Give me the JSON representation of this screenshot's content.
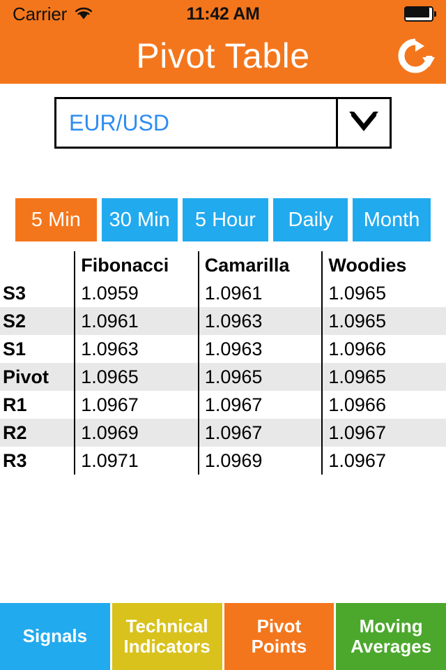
{
  "status_bar": {
    "carrier": "Carrier",
    "wifi_icon": "wifi-icon",
    "time": "11:42 AM",
    "battery_icon": "battery-full-icon"
  },
  "header": {
    "title": "Pivot Table",
    "refresh_icon": "refresh-icon",
    "background_color": "#F4761C"
  },
  "symbol_selector": {
    "value": "EUR/USD",
    "chevron_icon": "chevron-down-icon",
    "value_color": "#2D8CF0"
  },
  "timeframes": {
    "active_index": 0,
    "active_color": "#F4761C",
    "inactive_color": "#22AAEE",
    "items": [
      {
        "label": "5 Min"
      },
      {
        "label": "30 Min"
      },
      {
        "label": "5 Hour"
      },
      {
        "label": "Daily"
      },
      {
        "label": "Month"
      }
    ]
  },
  "table": {
    "corner_label": "",
    "columns": [
      "Fibonacci",
      "Camarilla",
      "Woodies"
    ],
    "rows": [
      {
        "label": "S3",
        "values": [
          "1.0959",
          "1.0961",
          "1.0965"
        ]
      },
      {
        "label": "S2",
        "values": [
          "1.0961",
          "1.0963",
          "1.0965"
        ]
      },
      {
        "label": "S1",
        "values": [
          "1.0963",
          "1.0963",
          "1.0966"
        ]
      },
      {
        "label": "Pivot",
        "values": [
          "1.0965",
          "1.0965",
          "1.0965"
        ]
      },
      {
        "label": "R1",
        "values": [
          "1.0967",
          "1.0967",
          "1.0966"
        ]
      },
      {
        "label": "R2",
        "values": [
          "1.0969",
          "1.0967",
          "1.0967"
        ]
      },
      {
        "label": "R3",
        "values": [
          "1.0971",
          "1.0969",
          "1.0967"
        ]
      }
    ]
  },
  "bottom_bar": {
    "items": [
      {
        "label": "Signals",
        "color": "#22AAEE"
      },
      {
        "label": "Technical Indicators",
        "color": "#D9C21C"
      },
      {
        "label": "Pivot Points",
        "color": "#F4761C"
      },
      {
        "label": "Moving Averages",
        "color": "#4CA82C"
      }
    ]
  }
}
